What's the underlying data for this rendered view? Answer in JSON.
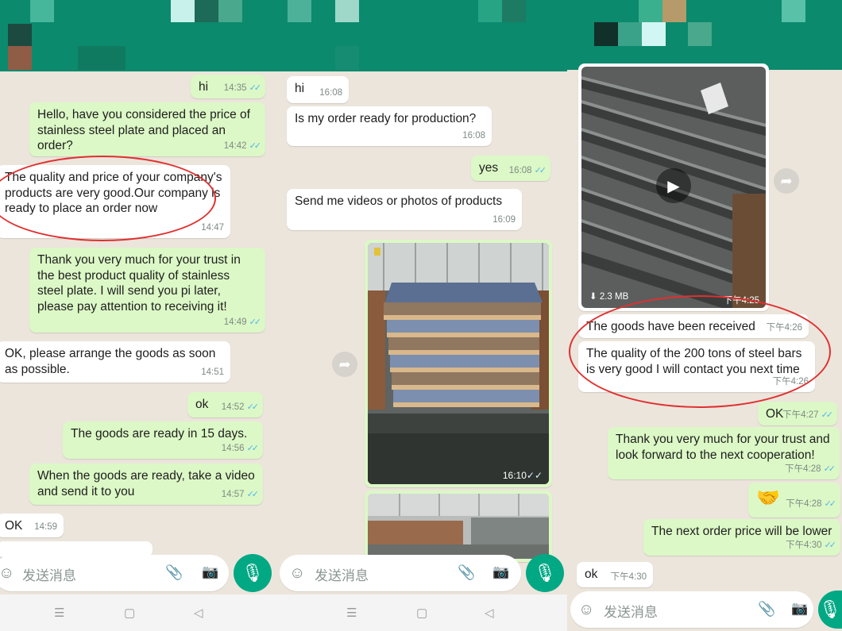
{
  "panel1": {
    "messages": [
      {
        "dir": "out",
        "text": "hi",
        "time": "14:35",
        "ticks": "✓✓"
      },
      {
        "dir": "out",
        "text": "Hello, have you considered the price of stainless steel plate and placed an order?",
        "time": "14:42",
        "ticks": "✓✓"
      },
      {
        "dir": "in",
        "text": "The quality and price of your company's products are very good.Our company is ready to place an order now",
        "time": "14:47"
      },
      {
        "dir": "out",
        "text": "Thank you very much for your trust in the best product quality of stainless steel plate.  I will send you pi later, please pay attention to receiving it!",
        "time": "14:49",
        "ticks": "✓✓"
      },
      {
        "dir": "in",
        "text": "OK, please arrange the goods as soon as possible.",
        "time": "14:51"
      },
      {
        "dir": "out",
        "text": "ok",
        "time": "14:52",
        "ticks": "✓✓"
      },
      {
        "dir": "out",
        "text": "The goods are ready in 15 days.",
        "time": "14:56",
        "ticks": "✓✓"
      },
      {
        "dir": "out",
        "text": "When the goods are ready, take a video and send it to you",
        "time": "14:57",
        "ticks": "✓✓"
      },
      {
        "dir": "in",
        "text": "OK",
        "time": "14:59"
      }
    ],
    "input_placeholder": "发送消息"
  },
  "panel2": {
    "messages": [
      {
        "dir": "in",
        "text": "hi",
        "time": "16:08"
      },
      {
        "dir": "in",
        "text": "Is my order ready for production?",
        "time": "16:08"
      },
      {
        "dir": "out",
        "text": "yes",
        "time": "16:08",
        "ticks": "✓✓"
      },
      {
        "dir": "in",
        "text": "Send me videos or photos of products",
        "time": "16:09"
      }
    ],
    "photo_time": "16:10",
    "photo_ticks": "✓✓",
    "input_placeholder": "发送消息"
  },
  "panel3": {
    "video_size": "2.3 MB",
    "video_time": "下午4:25",
    "messages": [
      {
        "dir": "in",
        "text": "The goods have been received",
        "time": "下午4:26"
      },
      {
        "dir": "in",
        "text": "The quality of the 200 tons of steel bars is very good I will contact you next time",
        "time": "下午4:26"
      },
      {
        "dir": "out",
        "text": "OK",
        "time": "下午4:27",
        "ticks": "✓✓"
      },
      {
        "dir": "out",
        "text": "Thank you very much for your trust and look forward to the next cooperation!",
        "time": "下午4:28",
        "ticks": "✓✓"
      },
      {
        "dir": "out",
        "text": "🤝",
        "time": "下午4:28",
        "ticks": "✓✓"
      },
      {
        "dir": "out",
        "text": "The next order price will be lower",
        "time": "下午4:30",
        "ticks": "✓✓"
      },
      {
        "dir": "in",
        "text": "ok",
        "time": "下午4:30"
      }
    ],
    "input_placeholder": "发送消息"
  },
  "icons": {
    "emoji": "emoji-icon",
    "attach": "paperclip-icon",
    "camera": "camera-icon",
    "mic": "microphone-icon",
    "forward": "forward-icon",
    "play": "play-icon",
    "download": "download-icon"
  },
  "colors": {
    "header": "#0b8a6d",
    "outgoing_bubble": "#dcf8c6",
    "incoming_bubble": "#ffffff",
    "chat_background": "#ece5dc",
    "mic_button": "#00a884",
    "read_ticks": "#4fb6ec",
    "highlight_oval": "#e03030"
  }
}
